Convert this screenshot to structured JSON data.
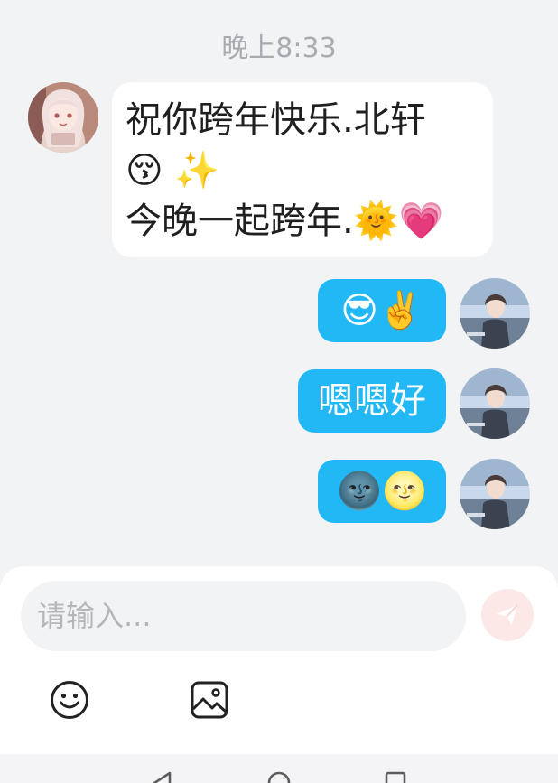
{
  "chat": {
    "timestamp": "晚上8:33",
    "messages": [
      {
        "side": "received",
        "sender_avatar": "avatar-girl",
        "lines": [
          "祝你跨年快乐.北轩",
          "😚 ✨",
          "今晚一起跨年.🌞💗"
        ]
      },
      {
        "side": "sent",
        "sender_avatar": "avatar-boy",
        "text": "😎✌️"
      },
      {
        "side": "sent",
        "sender_avatar": "avatar-boy",
        "text": "嗯嗯好"
      },
      {
        "side": "sent",
        "sender_avatar": "avatar-boy",
        "text": "🌚🌝"
      }
    ]
  },
  "composer": {
    "placeholder": "请输入...",
    "value": "",
    "send_icon": "send-icon",
    "tools": [
      "emoji-icon",
      "image-icon"
    ]
  },
  "navbar": {
    "buttons": [
      "back-icon",
      "home-icon",
      "recents-icon"
    ]
  },
  "colors": {
    "background": "#f2f3f5",
    "sent_bubble": "#22b8f6",
    "received_bubble": "#ffffff",
    "send_button": "#fde8e8"
  }
}
